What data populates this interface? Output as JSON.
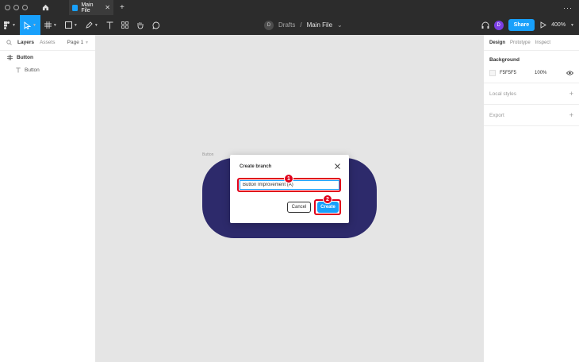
{
  "titlebar": {
    "tab_label": "Main File",
    "tab_close": "✕",
    "new_tab": "+",
    "more": "···"
  },
  "toolbar": {
    "draft_avatar": "D",
    "drafts": "Drafts",
    "separator": "/",
    "file_name": "Main File",
    "file_caret": "⌄",
    "user_avatar": "D",
    "share_label": "Share",
    "zoom_label": "400%"
  },
  "left_panel": {
    "tabs": [
      "Layers",
      "Assets"
    ],
    "page_label": "Page 1",
    "layers": [
      {
        "name": "Button",
        "type": "frame"
      },
      {
        "name": "Button",
        "type": "text"
      }
    ]
  },
  "canvas": {
    "frame_label": "Button",
    "frame_color": "#2d2a6b",
    "help_label": "?"
  },
  "right_panel": {
    "tabs": [
      "Design",
      "Prototype",
      "Inspect"
    ],
    "background_title": "Background",
    "bg_hex": "F5F5F5",
    "bg_opacity": "100%",
    "local_styles": "Local styles",
    "export": "Export",
    "plus": "+"
  },
  "dialog": {
    "title": "Create branch",
    "input_value": "Button Improvement (A)",
    "cancel_label": "Cancel",
    "create_label": "Create"
  },
  "annotations": {
    "step1": "1",
    "step2": "2",
    "highlight_color": "#e0001b"
  },
  "colors": {
    "accent": "#18a0fb",
    "chrome": "#2c2c2c",
    "canvas": "#e5e5e5"
  }
}
